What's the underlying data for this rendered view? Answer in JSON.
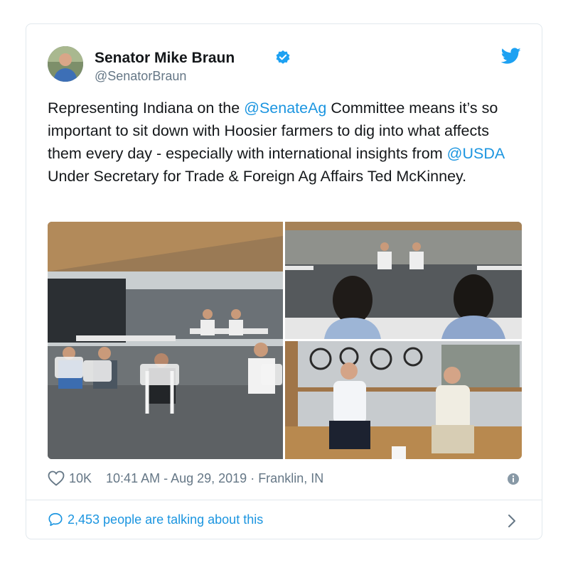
{
  "tweet": {
    "author_name": "Senator Mike Braun",
    "author_handle": "@SenatorBraun",
    "text": {
      "part1": "Representing Indiana on the ",
      "mention1": "@SenateAg",
      "part2": " Committee means it’s so important to sit down with Hoosier farmers to dig into what affects them every day - especially with international insights from ",
      "mention2": "@USDA",
      "part3": " Under Secretary for Trade & Foreign Ag Affairs Ted McKinney."
    },
    "likes": "10K",
    "timestamp": "10:41 AM - Aug 29, 2019",
    "location_sep": " · ",
    "location": "Franklin, IN"
  },
  "footer": {
    "talking": "2,453 people are talking about this"
  },
  "icons": {
    "verified": "verified-badge-icon",
    "bird": "twitter-bird-icon",
    "heart": "heart-outline-icon",
    "info": "info-icon",
    "bubble": "speech-bubble-icon",
    "chevron": "chevron-right-icon"
  },
  "colors": {
    "link": "#1b95e0",
    "secondary_text": "#657786",
    "border": "#e1e8ed"
  }
}
